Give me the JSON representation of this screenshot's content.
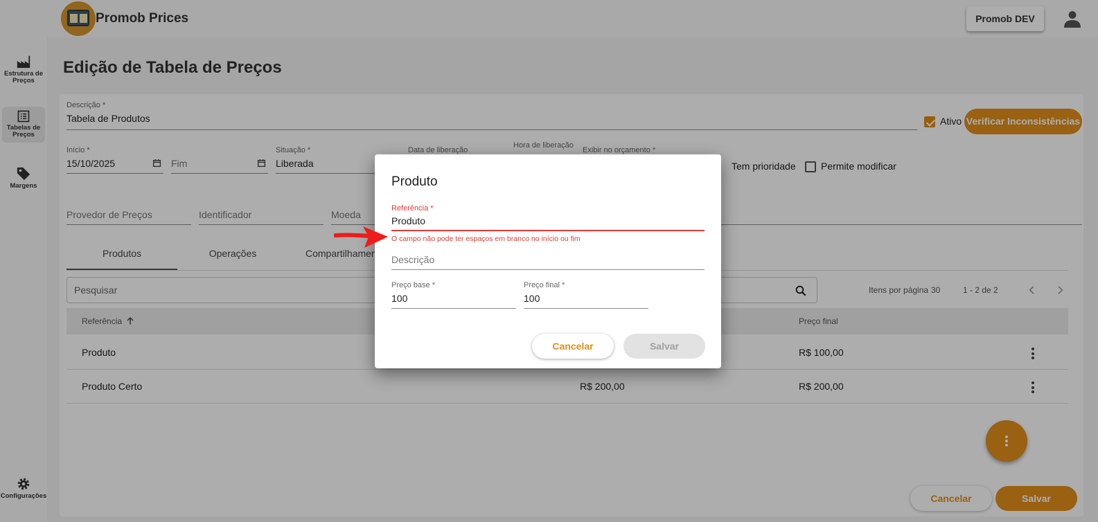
{
  "app": {
    "title": "Promob Prices",
    "env_label": "Promob DEV"
  },
  "sidebar": {
    "items": [
      {
        "label": "Estrutura de Preços",
        "icon": "factory-icon"
      },
      {
        "label": "Tabelas de Preços",
        "icon": "list-icon"
      },
      {
        "label": "Margens",
        "icon": "tag-icon"
      },
      {
        "label": "Configurações",
        "icon": "gear-icon"
      }
    ]
  },
  "page": {
    "title": "Edição de Tabela de Preços"
  },
  "form": {
    "descricao_label": "Descrição *",
    "descricao_value": "Tabela de Produtos",
    "ativo_label": "Ativo",
    "ativo_checked": true,
    "verify_button": "Verificar Inconsistências",
    "inicio_label": "Início *",
    "inicio_value": "15/10/2025",
    "fim_placeholder": "Fim",
    "situacao_label": "Situação *",
    "situacao_value": "Liberada",
    "data_liberacao_label": "Data de liberação",
    "hora_liberacao_label": "Hora de liberação",
    "exibir_label": "Exibir no orçamento *",
    "tem_prioridade_label": "Tem prioridade",
    "permite_modificar_label": "Permite modificar",
    "provedor_placeholder": "Provedor de Preços",
    "identificador_placeholder": "Identificador",
    "moeda_placeholder": "Moeda"
  },
  "tabs": [
    {
      "label": "Produtos",
      "active": true
    },
    {
      "label": "Operações",
      "active": false
    },
    {
      "label": "Compartilhamento",
      "active": false
    }
  ],
  "search": {
    "placeholder": "Pesquisar"
  },
  "pagination": {
    "items_per_page_label": "Itens por página",
    "items_per_page": "30",
    "range": "1 - 2 de 2"
  },
  "table": {
    "headers": {
      "referencia": "Referência",
      "preco_final": "Preço final"
    },
    "rows": [
      {
        "referencia": "Produto",
        "preco_base": "",
        "preco_final": "R$ 100,00"
      },
      {
        "referencia": "Produto Certo",
        "preco_base": "R$ 200,00",
        "preco_final": "R$ 200,00"
      }
    ]
  },
  "footer": {
    "cancel": "Cancelar",
    "save": "Salvar"
  },
  "dialog": {
    "title": "Produto",
    "referencia_label": "Referência *",
    "referencia_value": "Produto",
    "referencia_error": "O campo não pode ter espaços em branco no início ou fim",
    "descricao_placeholder": "Descrição",
    "preco_base_label": "Preço base *",
    "preco_base_value": "100",
    "preco_final_label": "Preço final *",
    "preco_final_value": "100",
    "cancel": "Cancelar",
    "save": "Salvar"
  },
  "colors": {
    "accent": "#e28f1a",
    "error": "#e53935",
    "arrow": "#ee1c1c"
  }
}
